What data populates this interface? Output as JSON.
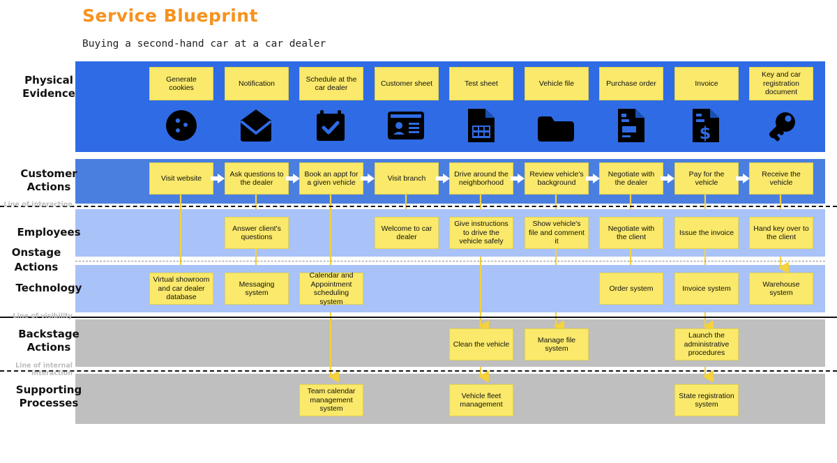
{
  "header": {
    "title": "Service Blueprint",
    "subtitle": "Buying a second-hand car at a car dealer",
    "title_color": "#F6921E"
  },
  "colors": {
    "physical_evidence_band": "#2F6BE5",
    "customer_actions_band": "#4A7FE0",
    "employees_band": "#A9C2F7",
    "technology_band": "#A9C2F7",
    "backstage_band": "#BFBFBF",
    "supporting_band": "#BFBFBF",
    "note_fill": "#FAE96B",
    "connector": "#F5D13B"
  },
  "bands": {
    "physical_evidence": {
      "label_line1": "Physical",
      "label_line2": "Evidence"
    },
    "customer_actions": {
      "label_line1": "Customer",
      "label_line2": "Actions"
    },
    "employees": {
      "label": "Employees"
    },
    "technology": {
      "label": "Technology"
    },
    "backstage": {
      "label_line1": "Backstage",
      "label_line2": "Actions"
    },
    "supporting": {
      "label_line1": "Supporting",
      "label_line2": "Processes"
    }
  },
  "side_labels": {
    "onstage": {
      "line1": "Onstage",
      "line2": "Actions"
    }
  },
  "separator_labels": {
    "line_of_interaction": "Line of interaction",
    "line_of_visibility": "Line of visibility",
    "line_of_internal_interaction_1": "Line of internal",
    "line_of_internal_interaction_2": "interaction"
  },
  "physical_evidence": [
    {
      "label": "Generate cookies",
      "icon": "cookie-icon"
    },
    {
      "label": "Notification",
      "icon": "envelope-icon"
    },
    {
      "label": "Schedule at the car dealer",
      "icon": "calendar-check-icon"
    },
    {
      "label": "Customer sheet",
      "icon": "id-card-icon"
    },
    {
      "label": "Test sheet",
      "icon": "spreadsheet-icon"
    },
    {
      "label": "Vehicle file",
      "icon": "folder-icon"
    },
    {
      "label": "Purchase order",
      "icon": "document-lines-icon"
    },
    {
      "label": "Invoice",
      "icon": "invoice-dollar-icon"
    },
    {
      "label": "Key and car registration document",
      "icon": "key-icon"
    }
  ],
  "customer_actions": [
    {
      "label": "Visit website"
    },
    {
      "label": "Ask questions to the dealer"
    },
    {
      "label": "Book an appt for a given vehicle"
    },
    {
      "label": "Visit branch"
    },
    {
      "label": "Drive around the neighborhood"
    },
    {
      "label": "Review vehicle's background"
    },
    {
      "label": "Negotiate with the dealer"
    },
    {
      "label": "Pay for the vehicle"
    },
    {
      "label": "Receive the vehicle"
    }
  ],
  "employees": [
    {
      "label": "Answer client's questions",
      "col": 2
    },
    {
      "label": "Welcome to car dealer",
      "col": 4
    },
    {
      "label": "Give instructions to drive the vehicle safely",
      "col": 5
    },
    {
      "label": "Show vehicle's file and comment it",
      "col": 6
    },
    {
      "label": "Negotiate with the client",
      "col": 7
    },
    {
      "label": "Issue the invoice",
      "col": 8
    },
    {
      "label": "Hand key over to the client",
      "col": 9
    }
  ],
  "technology": [
    {
      "label": "Virtual showroom and car dealer database",
      "col": 1
    },
    {
      "label": "Messaging system",
      "col": 2
    },
    {
      "label": "Calendar and Appointment scheduling system",
      "col": 3
    },
    {
      "label": "Order system",
      "col": 7
    },
    {
      "label": "Invoice system",
      "col": 8
    },
    {
      "label": "Warehouse system",
      "col": 9
    }
  ],
  "backstage": [
    {
      "label": "Clean the vehicle",
      "col": 5
    },
    {
      "label": "Manage file system",
      "col": 6
    },
    {
      "label": "Launch the administrative procedures",
      "col": 8
    }
  ],
  "supporting": [
    {
      "label": "Team calendar management system",
      "col": 3
    },
    {
      "label": "Vehicle fleet management",
      "col": 5
    },
    {
      "label": "State registration system",
      "col": 8
    }
  ]
}
